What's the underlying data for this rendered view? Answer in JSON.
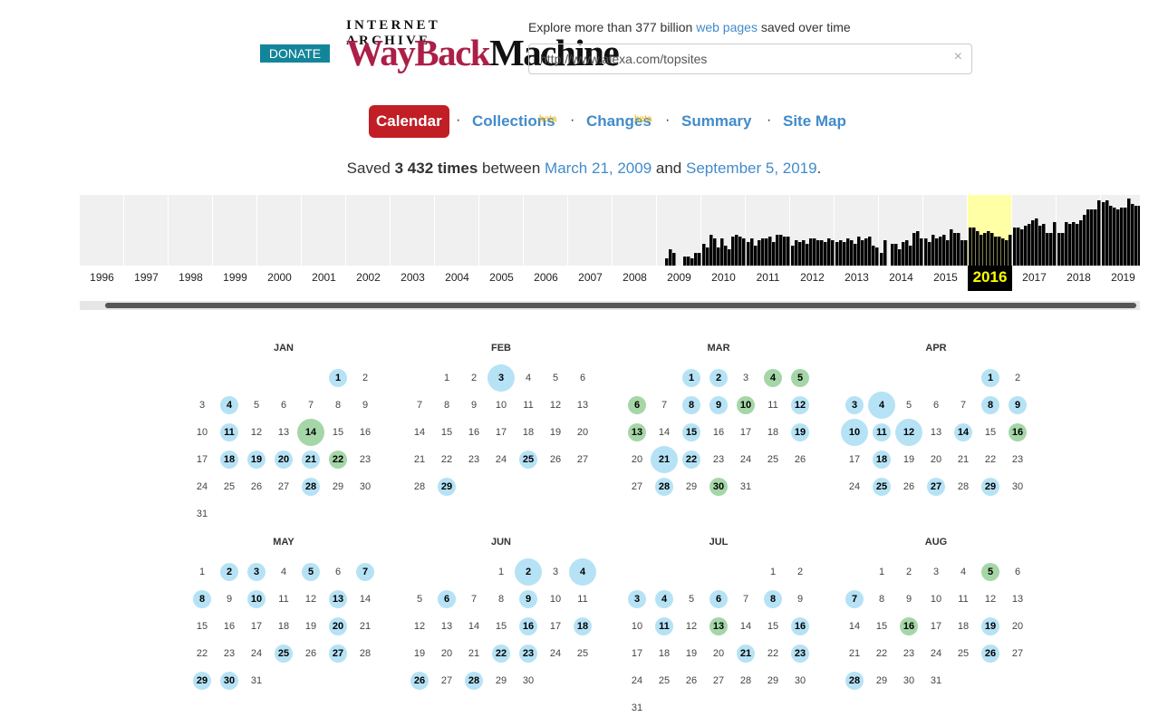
{
  "header": {
    "donate_label": "DONATE",
    "logo_top": "INTERNET ARCHIVE",
    "logo_wayback": "WayBack",
    "logo_machine": "Machine",
    "tagline_pre": "Explore more than 377 billion ",
    "tagline_link": "web pages",
    "tagline_post": " saved over time",
    "url_value": "http://www.alexa.com/topsites",
    "clear_icon": "×"
  },
  "nav": {
    "calendar": "Calendar",
    "collections": "Collections",
    "changes": "Changes",
    "summary": "Summary",
    "sitemap": "Site Map",
    "beta": "beta",
    "dot": "·"
  },
  "summary": {
    "pre": "Saved ",
    "count": "3 432 times",
    "mid": " between ",
    "start": "March 21, 2009",
    "and": " and ",
    "end": "September 5, 2019",
    "period": "."
  },
  "colors": {
    "accent": "#c11e25",
    "link": "#428bca",
    "capture_blue": "#b6e2f5",
    "capture_green": "#a5d6a7",
    "current_year_bg": "#ffffa5",
    "donate": "#13859a"
  },
  "timeline": {
    "years": [
      "1996",
      "1997",
      "1998",
      "1999",
      "2000",
      "2001",
      "2002",
      "2003",
      "2004",
      "2005",
      "2006",
      "2007",
      "2008",
      "2009",
      "2010",
      "2011",
      "2012",
      "2013",
      "2014",
      "2015",
      "2016",
      "2017",
      "2018",
      "2019"
    ],
    "current_year": "2016",
    "captures_per_month": [
      [
        0,
        0,
        0,
        0,
        0,
        0,
        0,
        0,
        0,
        0,
        0,
        0
      ],
      [
        0,
        0,
        0,
        0,
        0,
        0,
        0,
        0,
        0,
        0,
        0,
        0
      ],
      [
        0,
        0,
        0,
        0,
        0,
        0,
        0,
        0,
        0,
        0,
        0,
        0
      ],
      [
        0,
        0,
        0,
        0,
        0,
        0,
        0,
        0,
        0,
        0,
        0,
        0
      ],
      [
        0,
        0,
        0,
        0,
        0,
        0,
        0,
        0,
        0,
        0,
        0,
        0
      ],
      [
        0,
        0,
        0,
        0,
        0,
        0,
        0,
        0,
        0,
        0,
        0,
        0
      ],
      [
        0,
        0,
        0,
        0,
        0,
        0,
        0,
        0,
        0,
        0,
        0,
        0
      ],
      [
        0,
        0,
        0,
        0,
        0,
        0,
        0,
        0,
        0,
        0,
        0,
        0
      ],
      [
        0,
        0,
        0,
        0,
        0,
        0,
        0,
        0,
        0,
        0,
        0,
        0
      ],
      [
        0,
        0,
        0,
        0,
        0,
        0,
        0,
        0,
        0,
        0,
        0,
        0
      ],
      [
        0,
        0,
        0,
        0,
        0,
        0,
        0,
        0,
        0,
        0,
        0,
        0
      ],
      [
        0,
        0,
        0,
        0,
        0,
        0,
        0,
        0,
        0,
        0,
        0,
        0
      ],
      [
        0,
        0,
        0,
        0,
        0,
        0,
        0,
        0,
        0,
        0,
        0,
        0
      ],
      [
        0,
        0,
        8,
        18,
        14,
        0,
        0,
        10,
        10,
        8,
        14,
        14
      ],
      [
        24,
        20,
        34,
        30,
        20,
        30,
        22,
        18,
        32,
        34,
        32,
        30
      ],
      [
        26,
        30,
        22,
        28,
        30,
        30,
        32,
        26,
        34,
        34,
        32,
        32
      ],
      [
        22,
        28,
        26,
        28,
        24,
        30,
        30,
        28,
        28,
        26,
        30,
        28
      ],
      [
        26,
        28,
        26,
        30,
        28,
        24,
        32,
        28,
        30,
        32,
        22,
        20
      ],
      [
        14,
        28,
        0,
        24,
        24,
        18,
        26,
        28,
        22,
        36,
        38,
        30
      ],
      [
        30,
        26,
        34,
        30,
        32,
        34,
        28,
        40,
        36,
        36,
        28,
        28
      ],
      [
        42,
        42,
        38,
        34,
        36,
        38,
        36,
        32,
        32,
        30,
        28,
        34
      ],
      [
        42,
        42,
        40,
        44,
        46,
        50,
        52,
        44,
        46,
        36,
        36,
        48
      ],
      [
        36,
        36,
        48,
        46,
        48,
        46,
        50,
        56,
        62,
        62,
        62,
        72
      ],
      [
        70,
        72,
        66,
        64,
        62,
        64,
        64,
        74,
        68,
        66,
        66,
        32
      ]
    ],
    "max_captures": 76
  },
  "calendar": {
    "months": [
      {
        "name": "JAN",
        "start": 5,
        "days": 31,
        "caps": {
          "1": "b",
          "4": "b",
          "11": "b",
          "14": "G",
          "18": "b",
          "19": "b",
          "20": "b",
          "21": "b",
          "22": "g",
          "28": "b"
        }
      },
      {
        "name": "FEB",
        "start": 1,
        "days": 29,
        "caps": {
          "3": "B",
          "25": "b",
          "29": "b"
        }
      },
      {
        "name": "MAR",
        "start": 2,
        "days": 31,
        "caps": {
          "1": "b",
          "2": "b",
          "4": "g",
          "5": "g",
          "6": "g",
          "8": "b",
          "9": "b",
          "10": "g",
          "12": "b",
          "13": "g",
          "15": "b",
          "19": "b",
          "21": "B",
          "22": "b",
          "28": "b",
          "30": "g"
        }
      },
      {
        "name": "APR",
        "start": 5,
        "days": 30,
        "caps": {
          "1": "b",
          "3": "b",
          "4": "B",
          "8": "b",
          "9": "b",
          "10": "B",
          "11": "b",
          "12": "B",
          "14": "b",
          "16": "g",
          "18": "b",
          "25": "b",
          "27": "b",
          "29": "b"
        }
      },
      {
        "name": "MAY",
        "start": 0,
        "days": 31,
        "caps": {
          "2": "b",
          "3": "b",
          "5": "b",
          "7": "b",
          "8": "b",
          "10": "b",
          "13": "b",
          "20": "b",
          "25": "b",
          "27": "b",
          "29": "b",
          "30": "b"
        }
      },
      {
        "name": "JUN",
        "start": 3,
        "days": 30,
        "caps": {
          "2": "B",
          "4": "B",
          "6": "b",
          "9": "b",
          "16": "b",
          "18": "b",
          "22": "b",
          "23": "b",
          "26": "b",
          "28": "b"
        }
      },
      {
        "name": "JUL",
        "start": 5,
        "days": 31,
        "caps": {
          "3": "b",
          "4": "b",
          "6": "b",
          "8": "b",
          "11": "b",
          "13": "g",
          "16": "b",
          "21": "b",
          "23": "b"
        }
      },
      {
        "name": "AUG",
        "start": 1,
        "days": 31,
        "caps": {
          "5": "g",
          "7": "b",
          "16": "g",
          "19": "b",
          "26": "b",
          "28": "b"
        }
      }
    ]
  }
}
